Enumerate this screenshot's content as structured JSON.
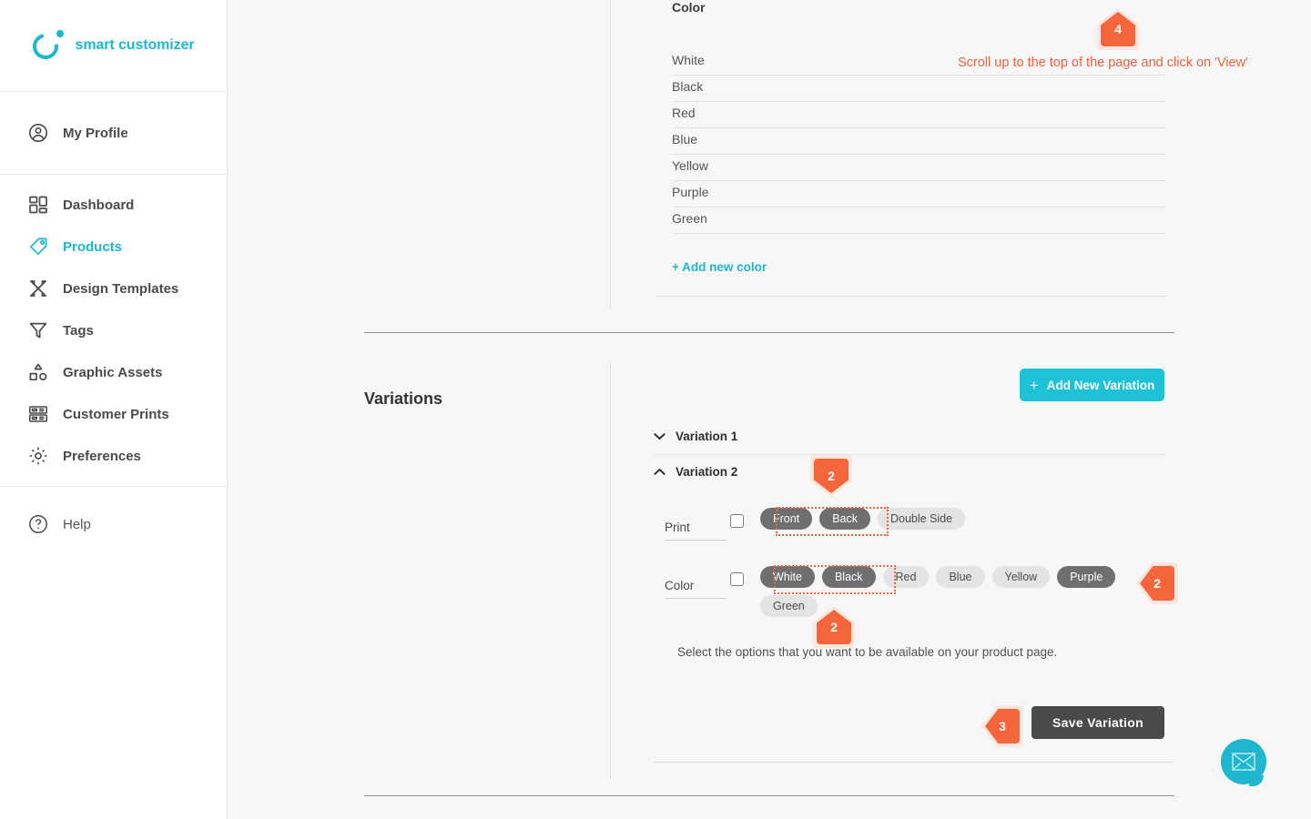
{
  "brand": {
    "name": "smart customizer",
    "accent": "#1bb8cf"
  },
  "sidebar": {
    "profile": {
      "label": "My Profile",
      "icon": "user-circle-icon"
    },
    "items": [
      {
        "label": "Dashboard",
        "icon": "dashboard-icon",
        "active": false
      },
      {
        "label": "Products",
        "icon": "tag-icon",
        "active": true
      },
      {
        "label": "Design Templates",
        "icon": "design-templates-icon",
        "active": false
      },
      {
        "label": "Tags",
        "icon": "funnel-icon",
        "active": false
      },
      {
        "label": "Graphic Assets",
        "icon": "shapes-icon",
        "active": false
      },
      {
        "label": "Customer Prints",
        "icon": "prints-icon",
        "active": false
      },
      {
        "label": "Preferences",
        "icon": "gear-icon",
        "active": false
      }
    ],
    "help": {
      "label": "Help",
      "icon": "question-circle-icon"
    }
  },
  "color_section": {
    "title": "Color",
    "colors": [
      "White",
      "Black",
      "Red",
      "Blue",
      "Yellow",
      "Purple",
      "Green"
    ],
    "add_label": "+ Add new color"
  },
  "variations": {
    "title": "Variations",
    "add_button": {
      "label": "Add New Variation",
      "plus": "+"
    },
    "groups": [
      {
        "label": "Variation 1",
        "expanded": false,
        "chevron": "chevron-down-icon"
      },
      {
        "label": "Variation 2",
        "expanded": true,
        "chevron": "chevron-up-icon"
      }
    ],
    "options": [
      {
        "label": "Print",
        "checked": false,
        "pills": [
          {
            "label": "Front",
            "selected": true
          },
          {
            "label": "Back",
            "selected": true
          },
          {
            "label": "Double Side",
            "selected": false
          }
        ]
      },
      {
        "label": "Color",
        "checked": false,
        "pills": [
          {
            "label": "White",
            "selected": true
          },
          {
            "label": "Black",
            "selected": true
          },
          {
            "label": "Red",
            "selected": false
          },
          {
            "label": "Blue",
            "selected": false
          },
          {
            "label": "Yellow",
            "selected": false
          },
          {
            "label": "Purple",
            "selected": true
          },
          {
            "label": "Green",
            "selected": false
          }
        ]
      }
    ],
    "hint": "Select the options that you want to be available on your product page.",
    "save_button": "Save Variation"
  },
  "annotations": {
    "accent": "#f4653c",
    "step_text": "Scroll up to the top of the page and click on 'View'",
    "badges": [
      {
        "number": "4",
        "direction": "up"
      },
      {
        "number": "2",
        "direction": "down"
      },
      {
        "number": "2",
        "direction": "left"
      },
      {
        "number": "2",
        "direction": "up"
      },
      {
        "number": "3",
        "direction": "left"
      }
    ]
  },
  "support": {
    "icon": "envelope-icon",
    "label": "Contact support"
  }
}
